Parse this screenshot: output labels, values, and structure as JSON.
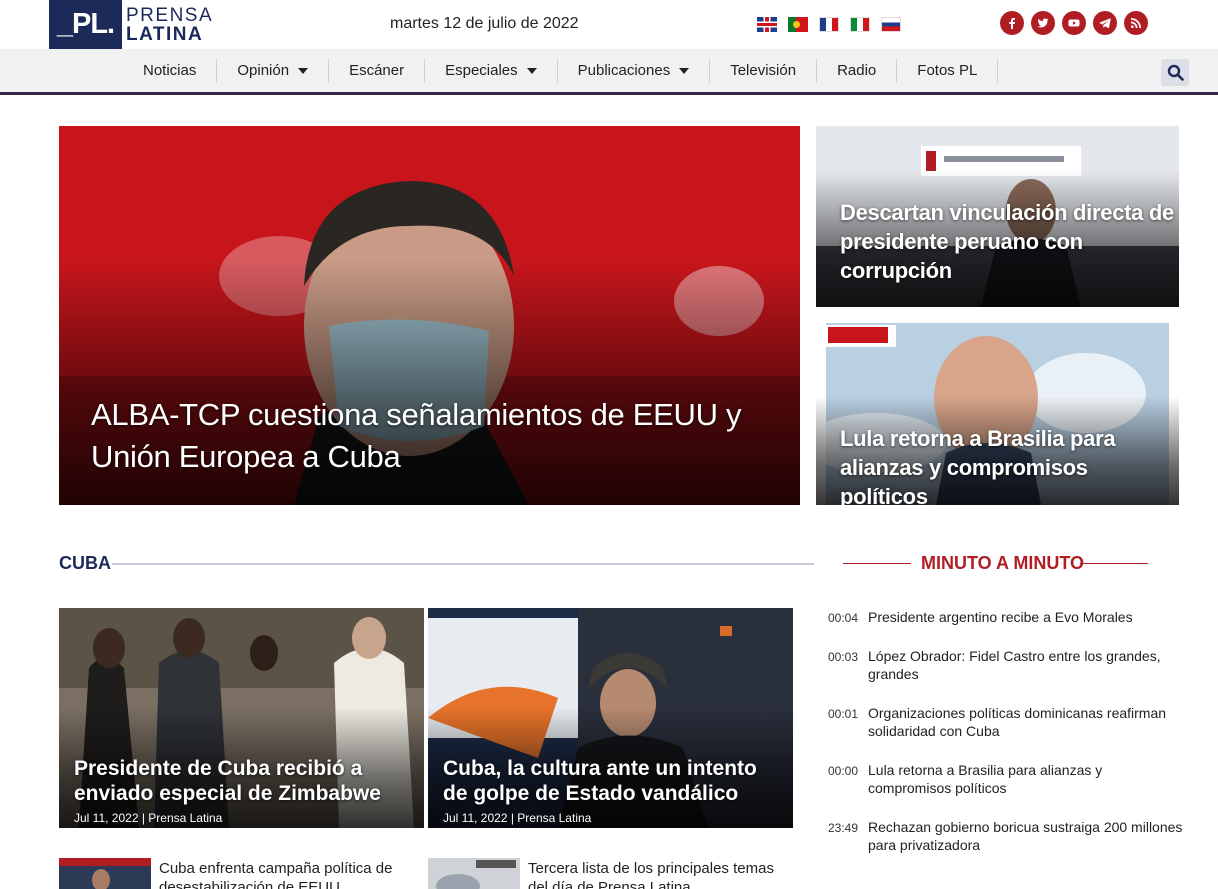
{
  "header": {
    "logo_mark": "_PL.",
    "logo_line1": "PRENSA",
    "logo_line2": "LATINA",
    "date": "martes 12 de julio de 2022",
    "languages": [
      "english",
      "portugues",
      "francais",
      "italiano",
      "russian"
    ],
    "social": [
      "facebook-icon",
      "twitter-icon",
      "youtube-icon",
      "telegram-icon",
      "rss-icon"
    ],
    "accent_color": "#b01e24",
    "brand_color": "#1c2a5a"
  },
  "nav": {
    "items": [
      {
        "label": "Noticias"
      },
      {
        "label": "Opinión"
      },
      {
        "label": "Escáner"
      },
      {
        "label": "Especiales"
      },
      {
        "label": "Publicaciones"
      },
      {
        "label": "Televisión"
      },
      {
        "label": "Radio"
      },
      {
        "label": "Fotos PL"
      }
    ]
  },
  "hero": {
    "main_title": "ALBA-TCP cuestiona señalamientos de EEUU y Unión Europea a Cuba",
    "side": [
      {
        "title": "Descartan vinculación directa de presidente peruano con corrupción"
      },
      {
        "title": "Lula retorna a Brasilia para alianzas y compromisos políticos"
      }
    ]
  },
  "cuba": {
    "heading": "CUBA",
    "cards": [
      {
        "title": "Presidente de Cuba recibió a enviado especial de Zimbabwe",
        "meta": "Jul 11, 2022 | Prensa Latina"
      },
      {
        "title": "Cuba, la cultura ante un intento de golpe de Estado vandálico",
        "meta": "Jul 11, 2022 | Prensa Latina"
      }
    ],
    "mini": [
      {
        "title": "Cuba enfrenta campaña política de desestabilización de EEUU"
      },
      {
        "title": "Tercera lista de los principales temas del día de Prensa Latina"
      }
    ]
  },
  "minuto": {
    "heading": "MINUTO A MINUTO",
    "items": [
      {
        "time": "00:04",
        "text": "Presidente argentino recibe a Evo Morales"
      },
      {
        "time": "00:03",
        "text": "López Obrador: Fidel Castro entre los grandes, grandes"
      },
      {
        "time": "00:01",
        "text": "Organizaciones políticas dominicanas reafirman solidaridad con Cuba"
      },
      {
        "time": "00:00",
        "text": "Lula retorna a Brasilia para alianzas y compromisos políticos"
      },
      {
        "time": "23:49",
        "text": "Rechazan gobierno boricua sustraiga 200 millones para privatizadora"
      }
    ]
  }
}
